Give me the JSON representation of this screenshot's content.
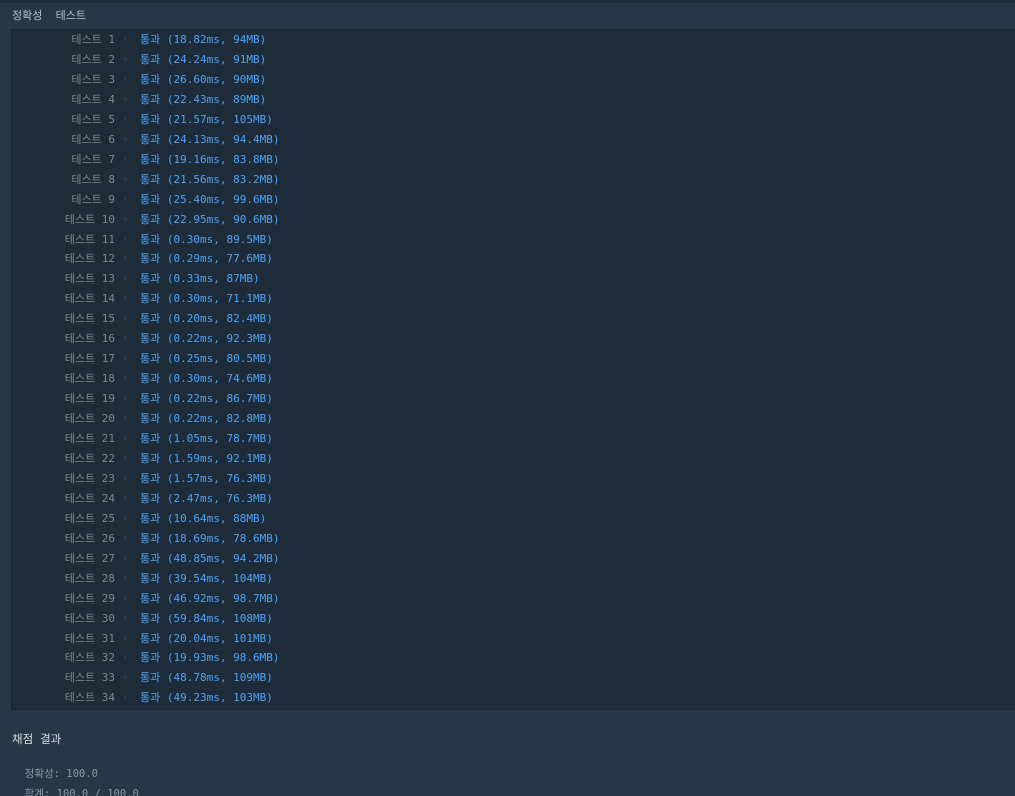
{
  "header": {
    "title": "정확성  테스트"
  },
  "tests": [
    {
      "label": "테스트 1",
      "status": "통과",
      "detail": "(18.82ms, 94MB)"
    },
    {
      "label": "테스트 2",
      "status": "통과",
      "detail": "(24.24ms, 91MB)"
    },
    {
      "label": "테스트 3",
      "status": "통과",
      "detail": "(26.60ms, 90MB)"
    },
    {
      "label": "테스트 4",
      "status": "통과",
      "detail": "(22.43ms, 89MB)"
    },
    {
      "label": "테스트 5",
      "status": "통과",
      "detail": "(21.57ms, 105MB)"
    },
    {
      "label": "테스트 6",
      "status": "통과",
      "detail": "(24.13ms, 94.4MB)"
    },
    {
      "label": "테스트 7",
      "status": "통과",
      "detail": "(19.16ms, 83.8MB)"
    },
    {
      "label": "테스트 8",
      "status": "통과",
      "detail": "(21.56ms, 83.2MB)"
    },
    {
      "label": "테스트 9",
      "status": "통과",
      "detail": "(25.40ms, 99.6MB)"
    },
    {
      "label": "테스트 10",
      "status": "통과",
      "detail": "(22.95ms, 90.6MB)"
    },
    {
      "label": "테스트 11",
      "status": "통과",
      "detail": "(0.30ms, 89.5MB)"
    },
    {
      "label": "테스트 12",
      "status": "통과",
      "detail": "(0.29ms, 77.6MB)"
    },
    {
      "label": "테스트 13",
      "status": "통과",
      "detail": "(0.33ms, 87MB)"
    },
    {
      "label": "테스트 14",
      "status": "통과",
      "detail": "(0.30ms, 71.1MB)"
    },
    {
      "label": "테스트 15",
      "status": "통과",
      "detail": "(0.20ms, 82.4MB)"
    },
    {
      "label": "테스트 16",
      "status": "통과",
      "detail": "(0.22ms, 92.3MB)"
    },
    {
      "label": "테스트 17",
      "status": "통과",
      "detail": "(0.25ms, 80.5MB)"
    },
    {
      "label": "테스트 18",
      "status": "통과",
      "detail": "(0.30ms, 74.6MB)"
    },
    {
      "label": "테스트 19",
      "status": "통과",
      "detail": "(0.22ms, 86.7MB)"
    },
    {
      "label": "테스트 20",
      "status": "통과",
      "detail": "(0.22ms, 82.8MB)"
    },
    {
      "label": "테스트 21",
      "status": "통과",
      "detail": "(1.05ms, 78.7MB)"
    },
    {
      "label": "테스트 22",
      "status": "통과",
      "detail": "(1.59ms, 92.1MB)"
    },
    {
      "label": "테스트 23",
      "status": "통과",
      "detail": "(1.57ms, 76.3MB)"
    },
    {
      "label": "테스트 24",
      "status": "통과",
      "detail": "(2.47ms, 76.3MB)"
    },
    {
      "label": "테스트 25",
      "status": "통과",
      "detail": "(10.64ms, 88MB)"
    },
    {
      "label": "테스트 26",
      "status": "통과",
      "detail": "(18.69ms, 78.6MB)"
    },
    {
      "label": "테스트 27",
      "status": "통과",
      "detail": "(48.85ms, 94.2MB)"
    },
    {
      "label": "테스트 28",
      "status": "통과",
      "detail": "(39.54ms, 104MB)"
    },
    {
      "label": "테스트 29",
      "status": "통과",
      "detail": "(46.92ms, 98.7MB)"
    },
    {
      "label": "테스트 30",
      "status": "통과",
      "detail": "(59.84ms, 108MB)"
    },
    {
      "label": "테스트 31",
      "status": "통과",
      "detail": "(20.04ms, 101MB)"
    },
    {
      "label": "테스트 32",
      "status": "통과",
      "detail": "(19.93ms, 98.6MB)"
    },
    {
      "label": "테스트 33",
      "status": "통과",
      "detail": "(48.78ms, 109MB)"
    },
    {
      "label": "테스트 34",
      "status": "통과",
      "detail": "(49.23ms, 103MB)"
    }
  ],
  "chevron_icon": "chevron-right-icon",
  "summary": {
    "title": "채점 결과",
    "accuracy_label": "정확성: ",
    "accuracy_value": "100.0",
    "total_label": "합계: ",
    "total_value": "100.0 / 100.0"
  },
  "colors": {
    "background": "#263747",
    "panel": "#1e2c3a",
    "pass": "#4ea3f7",
    "label": "#7b8894"
  }
}
